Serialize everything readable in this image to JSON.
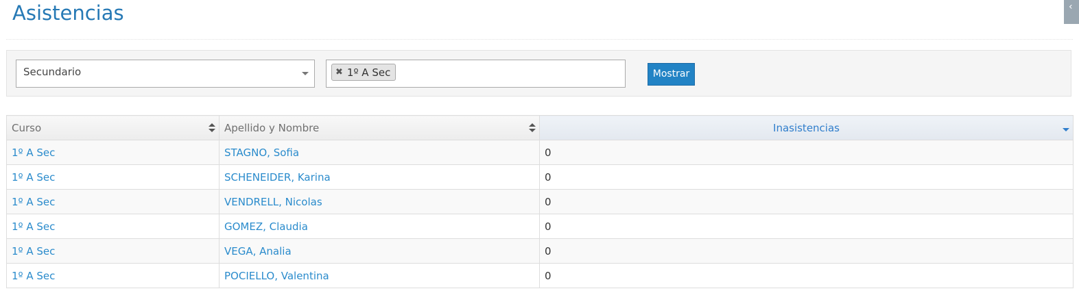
{
  "page": {
    "title": "Asistencias"
  },
  "filters": {
    "level_select": {
      "value": "Secundario"
    },
    "course_multiselect": {
      "chips": [
        {
          "label": "1º A Sec"
        }
      ]
    },
    "show_button": "Mostrar"
  },
  "table": {
    "columns": [
      {
        "label": "Curso",
        "sort": "both"
      },
      {
        "label": "Apellido y Nombre",
        "sort": "both"
      },
      {
        "label": "Inasistencias",
        "sort": "desc"
      }
    ],
    "rows": [
      {
        "curso": "1º A Sec",
        "nombre": "STAGNO, Sofia",
        "inasistencias": "0"
      },
      {
        "curso": "1º A Sec",
        "nombre": "SCHENEIDER, Karina",
        "inasistencias": "0"
      },
      {
        "curso": "1º A Sec",
        "nombre": "VENDRELL, Nicolas",
        "inasistencias": "0"
      },
      {
        "curso": "1º A Sec",
        "nombre": "GOMEZ, Claudia",
        "inasistencias": "0"
      },
      {
        "curso": "1º A Sec",
        "nombre": "VEGA, Analia",
        "inasistencias": "0"
      },
      {
        "curso": "1º A Sec",
        "nombre": "POCIELLO, Valentina",
        "inasistencias": "0"
      }
    ]
  },
  "colors": {
    "title": "#2679b5",
    "link": "#2a8bcc",
    "button": "#2283c5",
    "sorted_header": "#307ecc"
  },
  "icons": {
    "chip_remove": "close-icon",
    "select_caret": "chevron-down-icon",
    "sort_both": "sort-icon",
    "sort_desc": "sort-desc-icon",
    "corner": "chevron-left-icon"
  }
}
